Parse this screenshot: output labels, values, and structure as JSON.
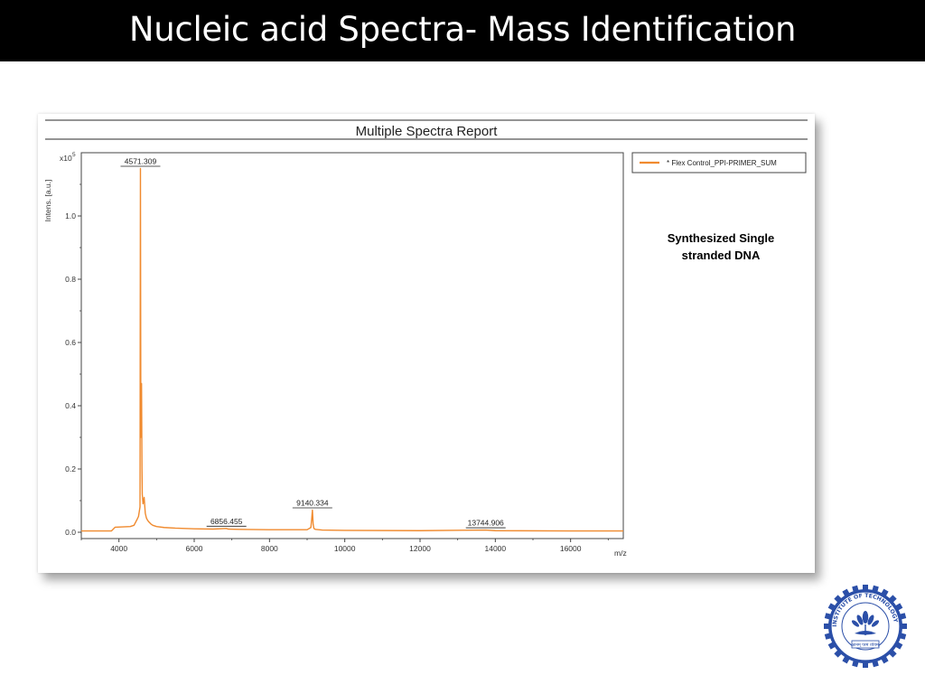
{
  "slide": {
    "title": "Nucleic acid  Spectra- Mass Identification",
    "caption_line1": "Synthesized Single",
    "caption_line2": "stranded DNA"
  },
  "logo": {
    "ring_text": "INDIAN INSTITUTE OF TECHNOLOGY BOMBAY",
    "motto": "ज्ञानम् परमं ध्येयम्",
    "color": "#2b4fa8",
    "icon": "lotus-icon"
  },
  "chart_data": {
    "type": "line",
    "title": "Multiple Spectra Report",
    "xlabel": "m/z",
    "ylabel": "Intens. [a.u.]",
    "y_multiplier_label": "x10",
    "y_multiplier_exp": "5",
    "xlim": [
      3000,
      17400
    ],
    "ylim": [
      -0.02,
      1.2
    ],
    "x_ticks": [
      4000,
      6000,
      8000,
      10000,
      12000,
      14000,
      16000
    ],
    "x_tick_labels": [
      "4000",
      "6000",
      "8000",
      "10000",
      "12000",
      "14000",
      "16000"
    ],
    "y_ticks": [
      0.0,
      0.2,
      0.4,
      0.6,
      0.8,
      1.0
    ],
    "y_tick_labels": [
      "0.0",
      "0.2",
      "0.4",
      "0.6",
      "0.8",
      "1.0"
    ],
    "grid": false,
    "legend_position": "top-right",
    "series": [
      {
        "name": "* Flex Control_PPI-PRIMER_SUM",
        "color": "#f08a2e",
        "x": [
          3000,
          3800,
          3850,
          3900,
          4300,
          4400,
          4480,
          4520,
          4560,
          4571.309,
          4582,
          4600,
          4612,
          4620,
          4640,
          4670,
          4700,
          4730,
          4760,
          4800,
          4850,
          4900,
          5000,
          5200,
          5500,
          6000,
          6500,
          6856.455,
          6900,
          7200,
          8000,
          9000,
          9100,
          9120,
          9140.334,
          9160,
          9180,
          9220,
          9400,
          10000,
          12000,
          13744.906,
          14000,
          16000,
          17400
        ],
        "y": [
          0.004,
          0.004,
          0.01,
          0.016,
          0.018,
          0.022,
          0.04,
          0.05,
          0.08,
          1.15,
          0.3,
          0.47,
          0.2,
          0.12,
          0.09,
          0.11,
          0.06,
          0.045,
          0.038,
          0.032,
          0.026,
          0.022,
          0.018,
          0.015,
          0.013,
          0.011,
          0.01,
          0.012,
          0.01,
          0.009,
          0.008,
          0.008,
          0.015,
          0.04,
          0.07,
          0.025,
          0.012,
          0.009,
          0.007,
          0.006,
          0.005,
          0.007,
          0.005,
          0.004,
          0.004
        ]
      }
    ],
    "annotations": [
      {
        "x": 4571.309,
        "y": 1.15,
        "text": "4571.309"
      },
      {
        "x": 6856.455,
        "y": 0.012,
        "text": "6856.455"
      },
      {
        "x": 9140.334,
        "y": 0.07,
        "text": "9140.334"
      },
      {
        "x": 13744.906,
        "y": 0.007,
        "text": "13744.906"
      }
    ]
  }
}
